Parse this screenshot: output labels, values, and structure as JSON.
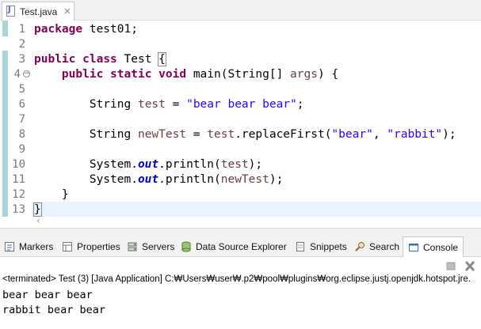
{
  "editor_tab": {
    "title": "Test.java",
    "close_glyph": "✕",
    "icon": "java-file-icon"
  },
  "code_lines": [
    {
      "num": "1",
      "text": "package test01;"
    },
    {
      "num": "2",
      "text": ""
    },
    {
      "num": "3",
      "text": "public class Test {"
    },
    {
      "num": "4",
      "text": "    public static void main(String[] args) {"
    },
    {
      "num": "5",
      "text": ""
    },
    {
      "num": "6",
      "text": "        String test = \"bear bear bear\";"
    },
    {
      "num": "7",
      "text": ""
    },
    {
      "num": "8",
      "text": "        String newTest = test.replaceFirst(\"bear\", \"rabbit\");"
    },
    {
      "num": "9",
      "text": ""
    },
    {
      "num": "10",
      "text": "        System.out.println(test);"
    },
    {
      "num": "11",
      "text": "        System.out.println(newTest);"
    },
    {
      "num": "12",
      "text": "    }"
    },
    {
      "num": "13",
      "text": "}"
    }
  ],
  "tokens": {
    "package": "package",
    "public": "public",
    "class": "class",
    "static": "static",
    "void": "void",
    "pkg_name": "test01;",
    "class_name": "Test",
    "brace_open": "{",
    "brace_close": "}",
    "main_sig": "main(String[] ",
    "args": "args",
    "sig_end": ") {",
    "string_type": "String",
    "test": "test",
    "newTest": "newTest",
    "assign": " = ",
    "str_bear3": "\"bear bear bear\"",
    "semicolon": ";",
    "dot_replace": ".replaceFirst(",
    "str_bear": "\"bear\"",
    "comma": ", ",
    "str_rabbit": "\"rabbit\"",
    "close_paren_semi": ");",
    "system": "System.",
    "out": "out",
    "println": ".println(",
    "close_stmt": ");"
  },
  "panel_tabs": [
    {
      "label": "Markers",
      "icon": "markers-icon"
    },
    {
      "label": "Properties",
      "icon": "properties-icon"
    },
    {
      "label": "Servers",
      "icon": "servers-icon"
    },
    {
      "label": "Data Source Explorer",
      "icon": "data-source-icon"
    },
    {
      "label": "Snippets",
      "icon": "snippets-icon"
    },
    {
      "label": "Search",
      "icon": "search-icon"
    },
    {
      "label": "Console",
      "icon": "console-icon",
      "active": true
    }
  ],
  "console": {
    "header": "<terminated> Test (3) [Java Application] C:₩Users₩user₩.p2₩pool₩plugins₩org.eclipse.justj.openjdk.hotspot.jre.",
    "output": [
      "bear bear bear",
      "rabbit bear bear"
    ]
  },
  "colors": {
    "keyword": "#7f0055",
    "string": "#2a00ff",
    "local_var": "#6a3e3e",
    "static_field": "#0000c0",
    "current_line": "#e8f2fe",
    "change_bar": "#a9d4d8"
  }
}
